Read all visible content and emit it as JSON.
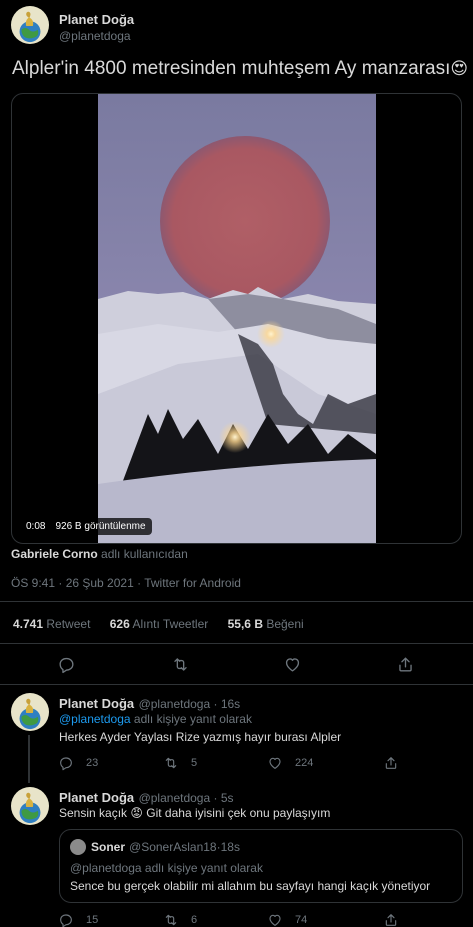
{
  "main_tweet": {
    "author_name": "Planet Doğa",
    "author_handle": "@planetdoga",
    "text": "Alpler'in 4800 metresinden muhteşem Ay manzarası",
    "emoji": "😍",
    "video": {
      "time": "0:08",
      "views": "926 B görüntülenme"
    },
    "credit_name": "Gabriele Corno",
    "credit_suffix": "adlı kullanıcıdan",
    "meta": "ÖS 9:41 · 26 Şub 2021 · Twitter for Android",
    "stats": {
      "retweets": "4.741",
      "retweets_label": "Retweet",
      "quotes": "626",
      "quotes_label": "Alıntı Tweetler",
      "likes": "55,6 B",
      "likes_label": "Beğeni"
    },
    "actions": [
      "reply-icon",
      "retweet-icon",
      "like-icon",
      "share-icon"
    ]
  },
  "replies": [
    {
      "author_name": "Planet Doğa",
      "author_handle": "@planetdoga",
      "time": "16s",
      "reply_to_handle": "@planetdoga",
      "reply_to_suffix": "adlı kişiye yanıt olarak",
      "text": "Herkes Ayder Yaylası Rize yazmış hayır burası Alpler",
      "counts": {
        "replies": "23",
        "retweets": "5",
        "likes": "224"
      }
    },
    {
      "author_name": "Planet Doğa",
      "author_handle": "@planetdoga",
      "time": "5s",
      "text_before": "Sensin kaçık",
      "emoji": "😡",
      "text_after": "Git daha iyisini çek onu paylaşıyım",
      "quote": {
        "author_name": "Soner",
        "author_handle": "@SonerAslan18",
        "time": "18s",
        "reply_line": "@planetdoga adlı kişiye yanıt olarak",
        "text": "Sence bu gerçek olabilir mi allahım bu sayfayı hangi kaçık yönetiyor"
      },
      "counts": {
        "replies": "15",
        "retweets": "6",
        "likes": "74"
      }
    }
  ],
  "colors": {
    "background": "#000000",
    "text": "#d9d9d9",
    "muted": "#6e767d",
    "link": "#1d9bf0",
    "border": "#2f3336"
  }
}
